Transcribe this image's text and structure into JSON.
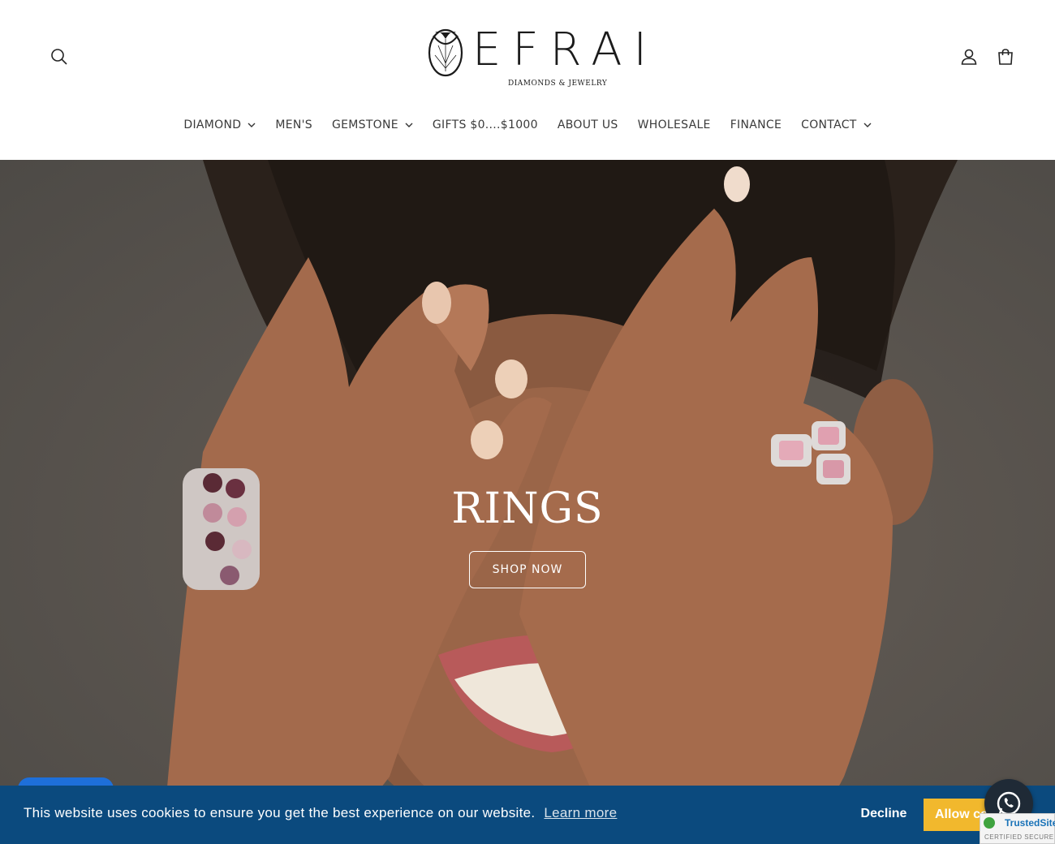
{
  "header": {
    "logo_word": "EFRAI",
    "logo_sub": "DIAMONDS & JEWELRY",
    "icons": {
      "search": "search-icon",
      "account": "account-icon",
      "cart": "cart-icon"
    }
  },
  "nav": {
    "items": [
      {
        "label": "DIAMOND",
        "has_dropdown": true
      },
      {
        "label": "MEN'S",
        "has_dropdown": false
      },
      {
        "label": "GEMSTONE",
        "has_dropdown": true
      },
      {
        "label": "GIFTS $0....$1000",
        "has_dropdown": false
      },
      {
        "label": "ABOUT US",
        "has_dropdown": false
      },
      {
        "label": "WHOLESALE",
        "has_dropdown": false
      },
      {
        "label": "FINANCE",
        "has_dropdown": false
      },
      {
        "label": "CONTACT",
        "has_dropdown": true
      }
    ]
  },
  "hero": {
    "title": "RINGS",
    "button_label": "SHOP NOW"
  },
  "cookie": {
    "message": "This website uses cookies to ensure you get the best experience on our website.",
    "learn_more": "Learn more",
    "decline": "Decline",
    "allow": "Allow cookies"
  },
  "trusted_site": {
    "name": "TrustedSite",
    "sub": "CERTIFIED SECURE"
  },
  "colors": {
    "cookie_bg": "#0b4a7e",
    "allow_bg": "#f1b82d",
    "chat_pill": "#1e6fd9"
  }
}
